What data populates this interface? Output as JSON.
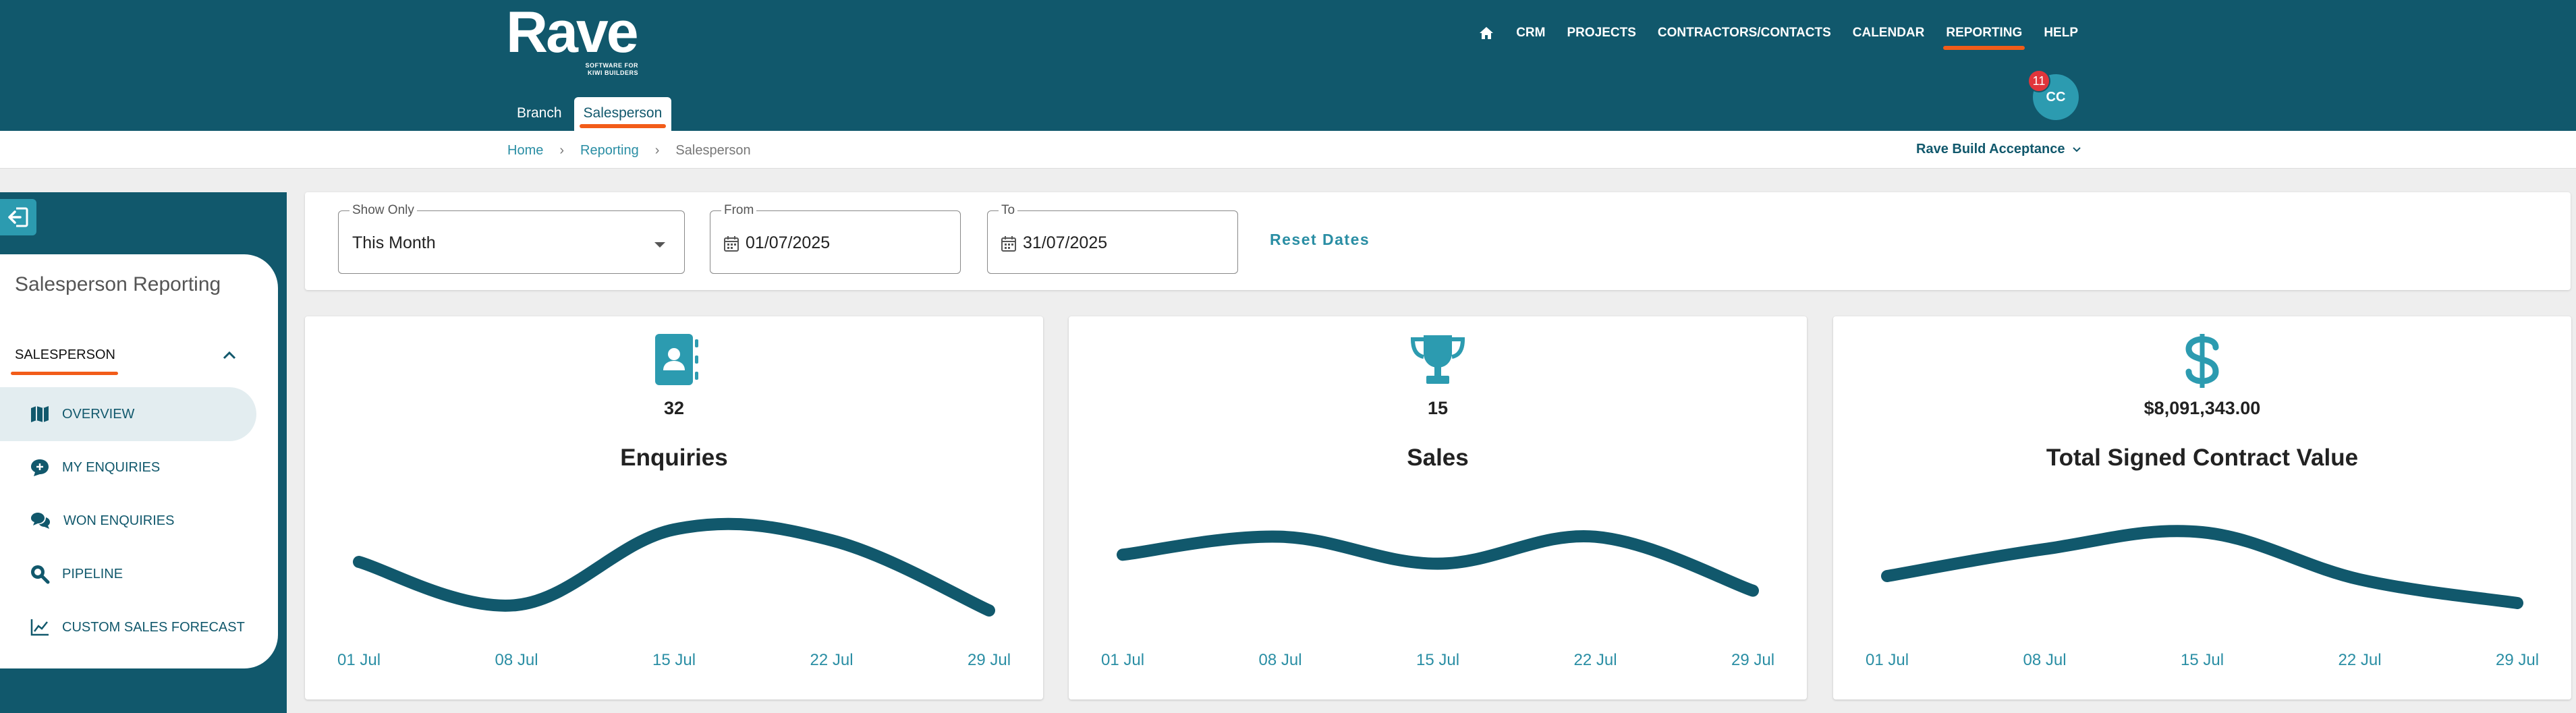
{
  "header": {
    "logo_text": "Rave",
    "logo_sub1": "SOFTWARE FOR",
    "logo_sub2": "KIWI BUILDERS",
    "nav": [
      {
        "label": "CRM"
      },
      {
        "label": "PROJECTS"
      },
      {
        "label": "CONTRACTORS/CONTACTS"
      },
      {
        "label": "CALENDAR"
      },
      {
        "label": "REPORTING",
        "active": true
      },
      {
        "label": "HELP"
      }
    ],
    "home_icon": "home-icon",
    "avatar_initials": "CC",
    "notification_count": "11",
    "subtabs": [
      {
        "label": "Branch"
      },
      {
        "label": "Salesperson",
        "active": true
      }
    ]
  },
  "breadcrumb": {
    "items": [
      "Home",
      "Reporting",
      "Salesperson"
    ],
    "separator": "›"
  },
  "environment": {
    "label": "Rave Build Acceptance"
  },
  "sidebar": {
    "title": "Salesperson Reporting",
    "section": "SALESPERSON",
    "items": [
      {
        "label": "OVERVIEW",
        "icon": "map-icon",
        "active": true
      },
      {
        "label": "MY ENQUIRIES",
        "icon": "chat-plus-icon"
      },
      {
        "label": "WON ENQUIRIES",
        "icon": "chats-icon"
      },
      {
        "label": "PIPELINE",
        "icon": "search-icon"
      },
      {
        "label": "CUSTOM SALES FORECAST",
        "icon": "line-chart-icon"
      }
    ]
  },
  "filters": {
    "show_only": {
      "label": "Show Only",
      "value": "This Month"
    },
    "from": {
      "label": "From",
      "value": "01/07/2025"
    },
    "to": {
      "label": "To",
      "value": "31/07/2025"
    },
    "reset_label": "Reset Dates"
  },
  "colors": {
    "brand": "#11586c",
    "accent": "#f25c19",
    "link": "#2a8ea4",
    "icon": "#2c9bb0"
  },
  "cards": [
    {
      "value": "32",
      "title": "Enquiries",
      "icon": "contacts-book-icon"
    },
    {
      "value": "15",
      "title": "Sales",
      "icon": "trophy-icon"
    },
    {
      "value": "$8,091,343.00",
      "title": "Total Signed Contract Value",
      "icon": "dollar-icon"
    }
  ],
  "chart_data": [
    {
      "type": "line",
      "categories": [
        "01 Jul",
        "08 Jul",
        "15 Jul",
        "22 Jul",
        "29 Jul"
      ],
      "series": [
        {
          "values": [
            6,
            2,
            9,
            8,
            1.5
          ]
        }
      ],
      "ylim": [
        0,
        10
      ],
      "grid": false
    },
    {
      "type": "line",
      "categories": [
        "01 Jul",
        "08 Jul",
        "15 Jul",
        "22 Jul",
        "29 Jul"
      ],
      "series": [
        {
          "values": [
            4,
            5,
            3.5,
            5,
            2
          ]
        }
      ],
      "ylim": [
        0,
        6
      ],
      "grid": false
    },
    {
      "type": "line",
      "categories": [
        "01 Jul",
        "08 Jul",
        "15 Jul",
        "22 Jul",
        "29 Jul"
      ],
      "series": [
        {
          "values": [
            1500000,
            2300000,
            2800000,
            1400000,
            700000
          ]
        }
      ],
      "ylim": [
        0,
        3200000
      ],
      "grid": false
    }
  ]
}
